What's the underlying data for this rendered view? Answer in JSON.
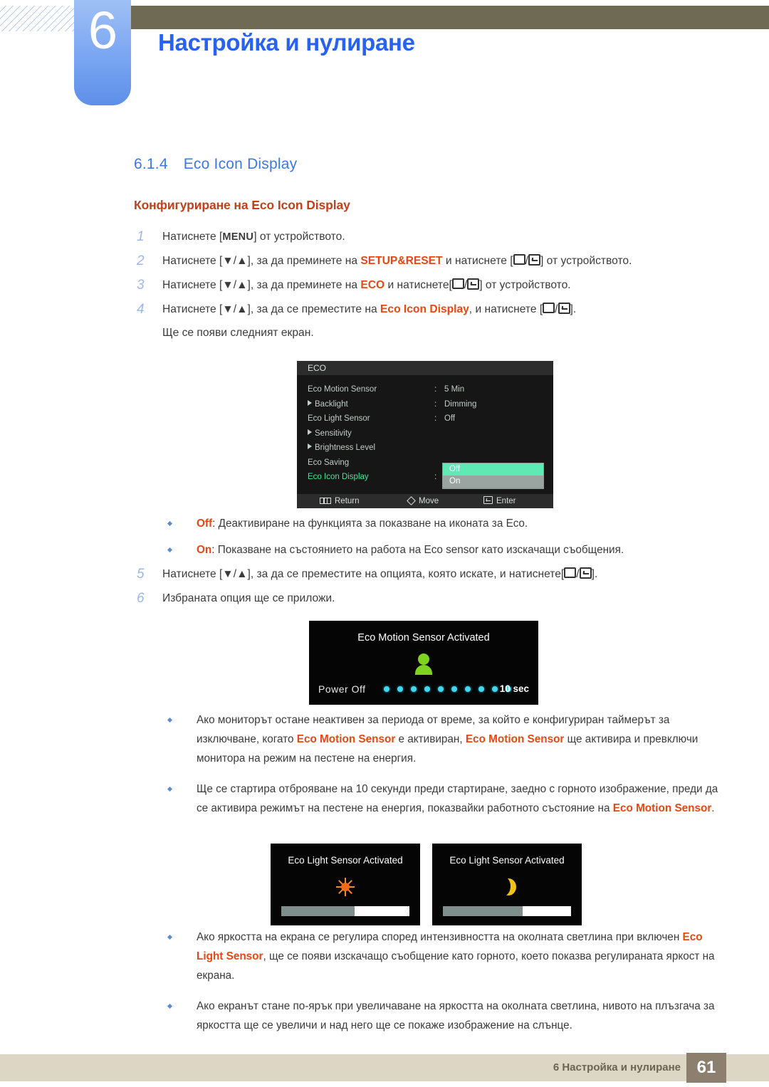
{
  "header": {
    "chapter_number": "6",
    "chapter_title": "Настройка и нулиране"
  },
  "section": {
    "number": "6.1.4",
    "title": "Eco Icon Display",
    "subtitle": "Конфигуриране на Eco Icon Display"
  },
  "steps": [
    {
      "num": "1",
      "before": "Натиснете [",
      "kb": "MENU",
      "after": "] от устройството.",
      "type": "menu"
    },
    {
      "num": "2",
      "p1": "Натиснете [▼/▲], за да преминете на ",
      "hl": "SETUP&RESET",
      "p2": " и натиснете [",
      "p3": "] от устройството.",
      "type": "keys"
    },
    {
      "num": "3",
      "p1": "Натиснете [▼/▲], за да преминете на ",
      "hl": "ECO",
      "p2": " и натиснете[",
      "p3": "] от устройството.",
      "type": "keys"
    },
    {
      "num": "4",
      "p1": "Натиснете [▼/▲], за да се преместите на ",
      "hl": "Eco Icon Display",
      "p2": ", и натиснете [",
      "p3": "].",
      "type": "keys",
      "sub": "Ще се появи следният екран."
    }
  ],
  "osd": {
    "title": "ECO",
    "rows": [
      {
        "label": "Eco Motion Sensor",
        "arrow": false,
        "colon": ":",
        "value": "5 Min",
        "active": false
      },
      {
        "label": "Backlight",
        "arrow": true,
        "colon": ":",
        "value": "Dimming",
        "active": false
      },
      {
        "label": "Eco Light Sensor",
        "arrow": false,
        "colon": ":",
        "value": "Off",
        "active": false
      },
      {
        "label": "Sensitivity",
        "arrow": true,
        "colon": "",
        "value": "",
        "active": false
      },
      {
        "label": "Brightness Level",
        "arrow": true,
        "colon": "",
        "value": "",
        "active": false
      },
      {
        "label": "Eco Saving",
        "arrow": false,
        "colon": "",
        "value": "",
        "active": false
      },
      {
        "label": "Eco Icon Display",
        "arrow": false,
        "colon": ":",
        "value": "",
        "active": true
      }
    ],
    "dropdown": {
      "selected": "Off",
      "unselected": "On"
    },
    "footer": {
      "return": "Return",
      "move": "Move",
      "enter": "Enter"
    },
    "colors": {
      "background": "#161616",
      "text": "#c2cbc6",
      "active_text": "#3ae89a",
      "highlight": "#5fe9b4",
      "option_bg": "#9aa5a2"
    }
  },
  "option_bullets": [
    {
      "hl": "Off",
      "text": ": Деактивиране на функцията за показване на иконата за Eco."
    },
    {
      "hl": "On",
      "text": ": Показване на състоянието на работа на Eco sensor като изскачащи съобщения."
    }
  ],
  "steps_after": [
    {
      "num": "5",
      "p1": "Натиснете [▼/▲], за да се преместите на опцията, която искате, и натиснете[",
      "p3": "].",
      "type": "keys"
    },
    {
      "num": "6",
      "plain": "Избраната опция ще се приложи."
    }
  ],
  "motion_popup": {
    "title": "Eco Motion Sensor Activated",
    "power_off_label": "Power Off",
    "seconds_label": "10 sec",
    "dot_count": 10,
    "icon": "person-icon",
    "icon_color": "#7ed321",
    "dot_color": "#3fd8f0"
  },
  "motion_bullets": [
    "Ако мониторът остане неактивен за периода от време, за който е конфигуриран таймерът за изключване, когато {Eco Motion Sensor} е активиран, {Eco Motion Sensor} ще активира и превключи монитора на режим на пестене на енергия.",
    "Ще се стартира отброяване на 10 секунди преди стартиране, заедно с горното изображение, преди да се активира режимът на пестене на енергия, показвайки работното състояние на {Eco Motion Sensor}."
  ],
  "light_popups": [
    {
      "title": "Eco Light Sensor Activated",
      "icon": "sun-icon",
      "icon_color": "#f26a15",
      "fill_percent": 57
    },
    {
      "title": "Eco Light Sensor Activated",
      "icon": "moon-icon",
      "icon_color": "#f2c21a",
      "fill_percent": 62
    }
  ],
  "light_bullets": [
    "Ако яркостта на екрана се регулира според интензивността на околната светлина при включен {Eco Light Sensor}, ще се появи изскачащо съобщение като горното, което показва регулираната яркост на екрана.",
    "Ако екранът стане по-ярък при увеличаване на яркостта на околната светлина, нивото на плъзгача за яркостта ще се увеличи и над него ще се покаже изображение на слънце."
  ],
  "footer": {
    "text": "6 Настройка и нулиране",
    "page": "61"
  },
  "colors": {
    "header_bar": "#6e6a53",
    "chapter_blue": "#2763f0",
    "section_blue": "#3b78e8",
    "accent_red": "#c0411b",
    "highlight_orange": "#e8470f",
    "footer_bar": "#ddd6c4",
    "footer_page_bg": "#8d7f6e"
  }
}
